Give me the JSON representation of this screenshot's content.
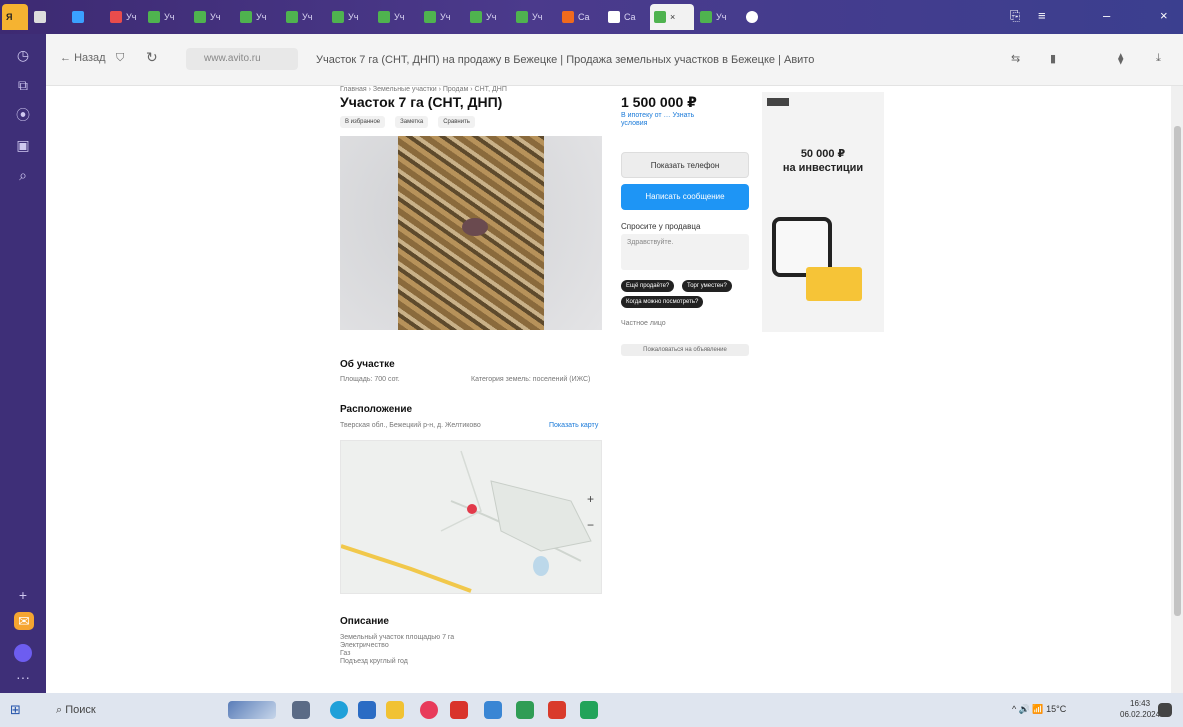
{
  "browser": {
    "tabs": [
      {
        "label": ""
      },
      {
        "label": ""
      },
      {
        "label": "Уч"
      },
      {
        "label": "Уч"
      },
      {
        "label": "Уч"
      },
      {
        "label": "Уч"
      },
      {
        "label": "Уч"
      },
      {
        "label": "Уч"
      },
      {
        "label": "Уч"
      },
      {
        "label": "Уч"
      },
      {
        "label": "Уч"
      },
      {
        "label": "Уч"
      },
      {
        "label": "Ca"
      },
      {
        "label": "Ca"
      },
      {
        "label": "Уч"
      }
    ],
    "back_label": "Назад",
    "url": "www.avito.ru",
    "page_title": "Участок 7 га (СНТ, ДНП) на продажу в Бежецке | Продажа земельных участков в Бежецке | Авито"
  },
  "listing": {
    "breadcrumb": "Главная › Земельные участки › Продам › СНТ, ДНП",
    "title": "Участок 7 га (СНТ, ДНП)",
    "actions": [
      "В избранное",
      "Заметка",
      "Сравнить"
    ],
    "price": "1 500 000 ₽",
    "price_sub": "В ипотеку от … Узнать условия",
    "phone_button": "Показать телефон",
    "message_button": "Написать сообщение",
    "ask_label": "Спросите у продавца",
    "ask_placeholder": "Здравствуйте.",
    "quick_questions": [
      "Ещё продаёте?",
      "Торг уместен?",
      "Когда можно посмотреть?"
    ],
    "seller_note": "Частное лицо",
    "report_button": "Пожаловаться на объявление"
  },
  "ad": {
    "amount": "50 000 ₽",
    "caption": "на инвестиции"
  },
  "about": {
    "heading": "Об участке",
    "area": "Площадь: 700 сот.",
    "purpose": "Категория земель: поселений (ИЖС)"
  },
  "location": {
    "heading": "Расположение",
    "address": "Тверская обл., Бежецкий р-н, д. Желтиково",
    "map_link": "Показать карту"
  },
  "description": {
    "heading": "Описание",
    "lines": [
      "Земельный участок площадью 7 га",
      "Электричество",
      "Газ",
      "Подъезд круглый год"
    ]
  },
  "taskbar": {
    "search_label": "Поиск",
    "tray": "^ 🔊 📶 15°C",
    "time": "16:43",
    "date": "06.02.2024"
  }
}
